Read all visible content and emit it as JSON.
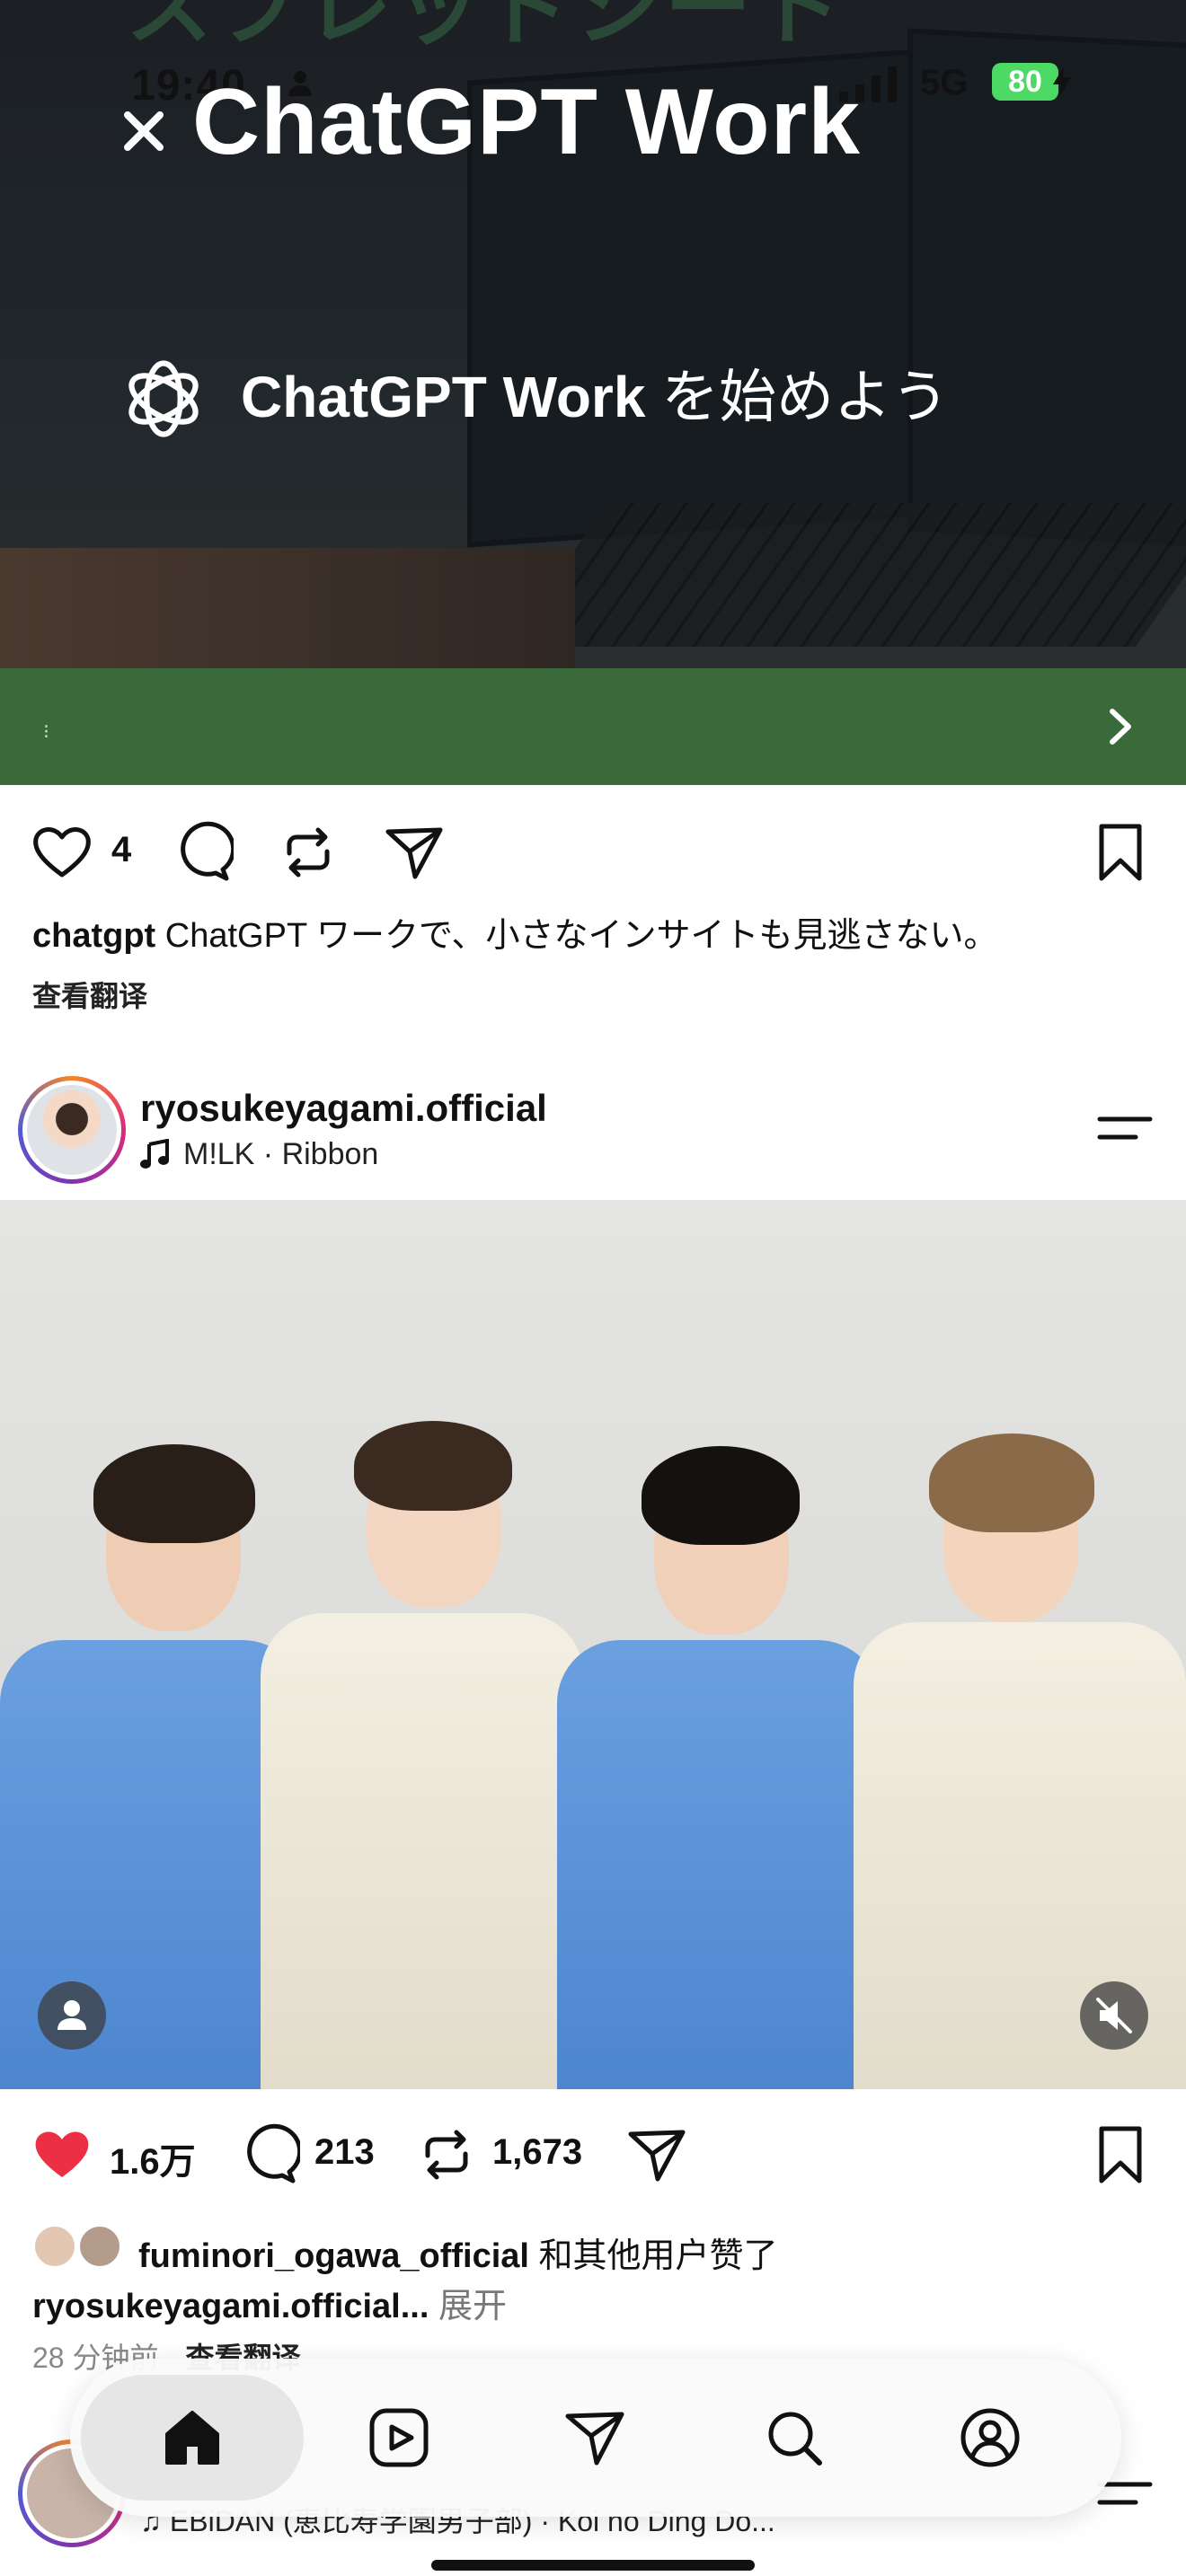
{
  "status_bar": {
    "time": "19:40",
    "network": "5G",
    "battery": "80"
  },
  "ad": {
    "background_text": "スプレッドシート",
    "brand": "ChatGPT Work",
    "tagline_bold": "ChatGPT Work",
    "tagline_rest": " を始めよう",
    "cta_text": "⁝",
    "actions": {
      "like_count": "4"
    },
    "caption_user": "chatgpt",
    "caption_text": " ChatGPT ワークで、小さなインサイトも見逃さない。",
    "translate": "查看翻译"
  },
  "post": {
    "username": "ryosukeyagami.official",
    "music_artist": "M!LK",
    "music_separator": " · ",
    "music_title": "Ribbon",
    "likes": "1.6万",
    "comments": "213",
    "reposts": "1,673",
    "liked_by_user": "fuminori_ogawa_official",
    "liked_by_suffix": " 和其他用户赞了",
    "caption_user": "ryosukeyagami.official...",
    "caption_expand": " 展开",
    "time_ago": "28 分钟前",
    "translate": "查看翻译"
  },
  "next_post": {
    "music": "EBiDAN (恵比寿学園男子部) · Koi no Ding Do..."
  },
  "tabbar": {
    "tabs": [
      {
        "icon": "home-icon",
        "active": true
      },
      {
        "icon": "reels-icon",
        "active": false
      },
      {
        "icon": "direct-message-icon",
        "active": false
      },
      {
        "icon": "search-icon",
        "active": false
      },
      {
        "icon": "profile-icon",
        "active": false
      }
    ]
  },
  "colors": {
    "cta_green": "#3a6a3a",
    "like_red": "#ed2f45",
    "battery_green": "#4cd964"
  }
}
